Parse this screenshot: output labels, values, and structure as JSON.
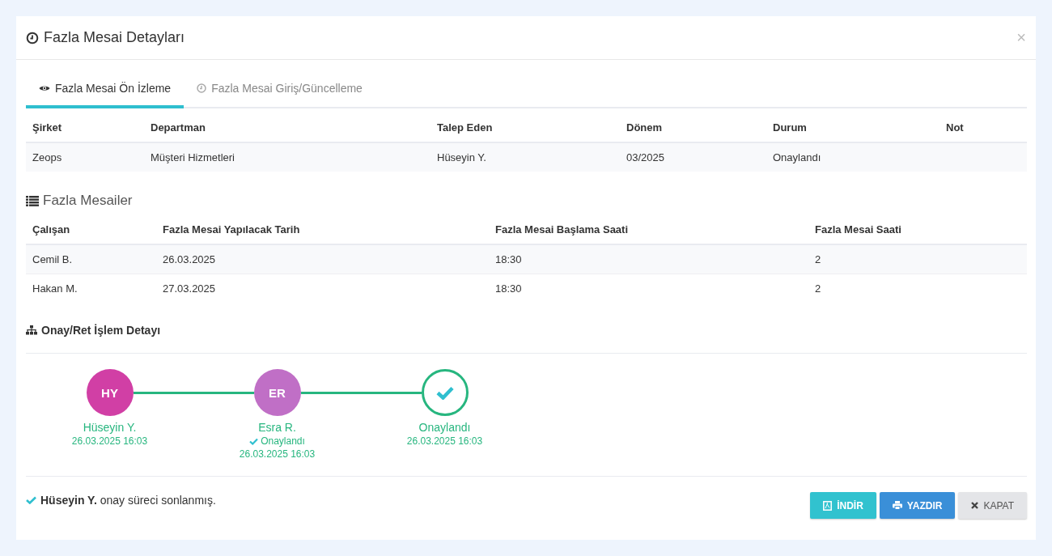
{
  "modal": {
    "title": "Fazla Mesai Detayları",
    "close": "×"
  },
  "tabs": [
    {
      "label": "Fazla Mesai Ön İzleme",
      "selected": true,
      "kind": "preview"
    },
    {
      "label": "Fazla Mesai Giriş/Güncelleme",
      "selected": false,
      "kind": "entry"
    }
  ],
  "summary_table": {
    "columns": [
      "Şirket",
      "Departman",
      "Talep Eden",
      "Dönem",
      "Durum",
      "Not"
    ],
    "rows": [
      [
        "Zeops",
        "Müşteri Hizmetleri",
        "Hüseyin Y.",
        "03/2025",
        "Onaylandı",
        ""
      ]
    ]
  },
  "overtime_section": {
    "title": "Fazla Mesailer"
  },
  "overtime_table": {
    "columns": [
      "Çalışan",
      "Fazla Mesai Yapılacak Tarih",
      "Fazla Mesai Başlama Saati",
      "Fazla Mesai Saati"
    ],
    "rows": [
      [
        "Cemil B.",
        "26.03.2025",
        "18:30",
        "2"
      ],
      [
        "Hakan M.",
        "27.03.2025",
        "18:30",
        "2"
      ]
    ]
  },
  "approval_section": {
    "title": "Onay/Ret İşlem Detayı"
  },
  "approval_steps": [
    {
      "kind": "person",
      "initials": "HY",
      "color": "#d13fa5",
      "name": "Hüseyin Y.",
      "datetime": "26.03.2025 16:03"
    },
    {
      "kind": "person",
      "initials": "ER",
      "color": "#c06fc6",
      "name": "Esra R.",
      "status": "Onaylandı",
      "datetime": "26.03.2025 16:03"
    },
    {
      "kind": "done",
      "name": "Onaylandı",
      "datetime": "26.03.2025 16:03"
    }
  ],
  "footer_message": "**Hüseyin Y.** onay süreci sonlanmış.",
  "buttons": [
    {
      "kind": "download",
      "label": "İNDİR"
    },
    {
      "kind": "print",
      "label": "YAZDIR"
    },
    {
      "kind": "close",
      "label": "KAPAT"
    }
  ]
}
